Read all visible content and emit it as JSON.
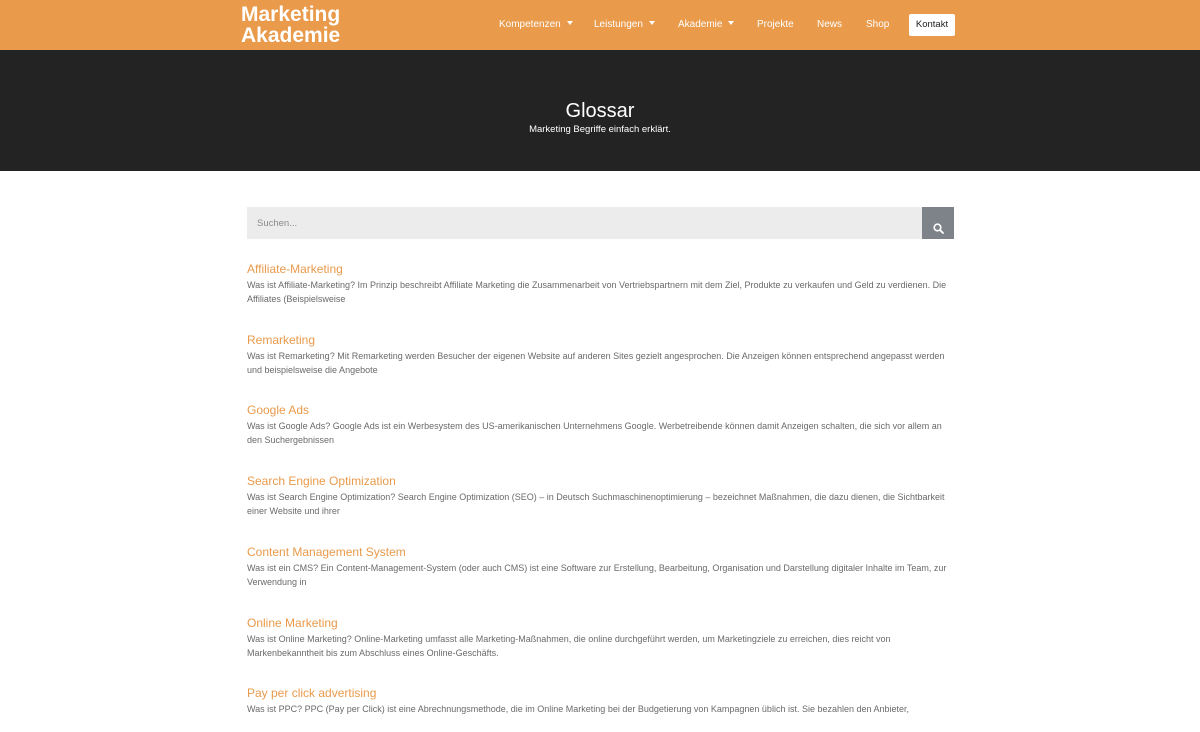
{
  "header": {
    "logo_line1": "Marketing",
    "logo_line2": "Akademie",
    "nav": {
      "kompetenzen": "Kompetenzen",
      "leistungen": "Leistungen",
      "akademie": "Akademie",
      "projekte": "Projekte",
      "news": "News",
      "shop": "Shop",
      "kontakt": "Kontakt"
    }
  },
  "hero": {
    "title": "Glossar",
    "subtitle": "Marketing Begriffe einfach erklärt."
  },
  "search": {
    "placeholder": "Suchen...",
    "icon": "search-icon"
  },
  "entries": [
    {
      "title": "Affiliate-Marketing",
      "text": "Was ist Affiliate-Marketing? Im Prinzip beschreibt Affiliate Marketing die Zusammenarbeit von Vertriebspartnern mit dem Ziel, Produkte zu verkaufen und Geld zu verdienen. Die Affiliates (Beispielsweise"
    },
    {
      "title": "Remarketing",
      "text": "Was ist Remarketing? Mit Remarketing werden Besucher der eigenen Website auf anderen Sites gezielt angesprochen. Die Anzeigen können entsprechend angepasst werden und beispielsweise die Angebote"
    },
    {
      "title": "Google Ads",
      "text": "Was ist Google Ads? Google Ads ist ein Werbesystem des US-amerikanischen Unternehmens Google. Werbetreibende können damit Anzeigen schalten, die sich vor allem an den Suchergebnissen"
    },
    {
      "title": "Search Engine Optimization",
      "text": "Was ist Search Engine Optimization? Search Engine Optimization (SEO) – in Deutsch Suchmaschinenoptimierung –  bezeichnet Maßnahmen, die dazu dienen, die Sichtbarkeit einer Website und ihrer"
    },
    {
      "title": "Content Management System",
      "text": "Was ist ein CMS? Ein Content-Management-System (oder auch CMS) ist eine Software zur Erstellung, Bearbeitung, Organisation und Darstellung digitaler Inhalte im Team,  zur Verwendung in"
    },
    {
      "title": "Online Marketing",
      "text": "Was ist Online Marketing? Online-Marketing umfasst alle Marketing-Maßnahmen, die online durchgeführt werden, um Marketingziele zu erreichen, dies reicht von Markenbekanntheit bis zum Abschluss eines Online-Geschäfts."
    },
    {
      "title": "Pay per click advertising",
      "text": "Was ist PPC? PPC (Pay per Click) ist eine Abrechnungsmethode, die im Online Marketing bei der Budgetierung von Kampagnen üblich ist. Sie bezahlen den Anbieter,"
    }
  ],
  "colors": {
    "brand_orange": "#e99a4b",
    "hero_dark": "#232323",
    "search_button": "#7d8388"
  }
}
